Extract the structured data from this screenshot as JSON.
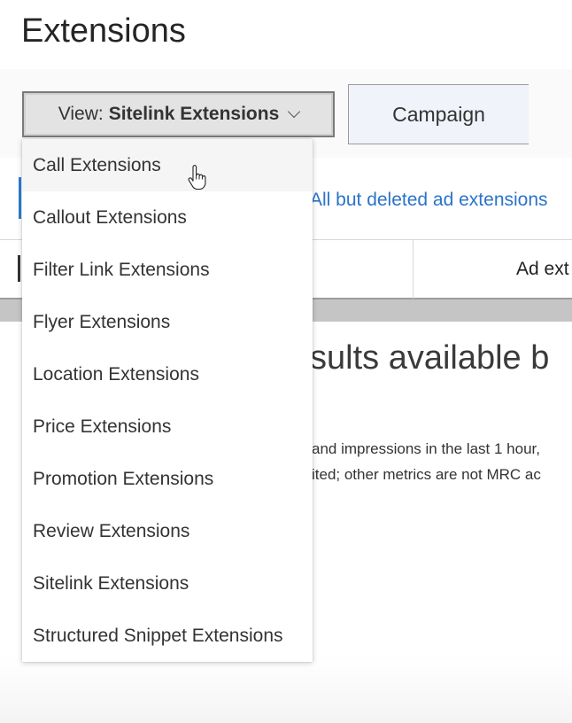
{
  "page": {
    "title": "Extensions"
  },
  "view_dropdown": {
    "prefix": "View:",
    "selected": "Sitelink Extensions"
  },
  "campaign_tab": {
    "label": "Campaign"
  },
  "filter": {
    "link_text": "All but deleted ad extensions"
  },
  "table": {
    "column_header": "Ad ext"
  },
  "results": {
    "message": "sults available b",
    "note_line1": "and impressions in the last 1 hour,",
    "note_line2": "ited; other metrics are not MRC ac"
  },
  "dropdown_menu": {
    "hovered_index": 0,
    "items": [
      {
        "label": "Call Extensions"
      },
      {
        "label": "Callout Extensions"
      },
      {
        "label": "Filter Link Extensions"
      },
      {
        "label": "Flyer Extensions"
      },
      {
        "label": "Location Extensions"
      },
      {
        "label": "Price Extensions"
      },
      {
        "label": "Promotion Extensions"
      },
      {
        "label": "Review Extensions"
      },
      {
        "label": "Sitelink Extensions"
      },
      {
        "label": "Structured Snippet Extensions"
      }
    ]
  },
  "colors": {
    "link": "#2b73c9",
    "accent": "#2b7cd3",
    "menu_hover": "#f5f5f5"
  }
}
